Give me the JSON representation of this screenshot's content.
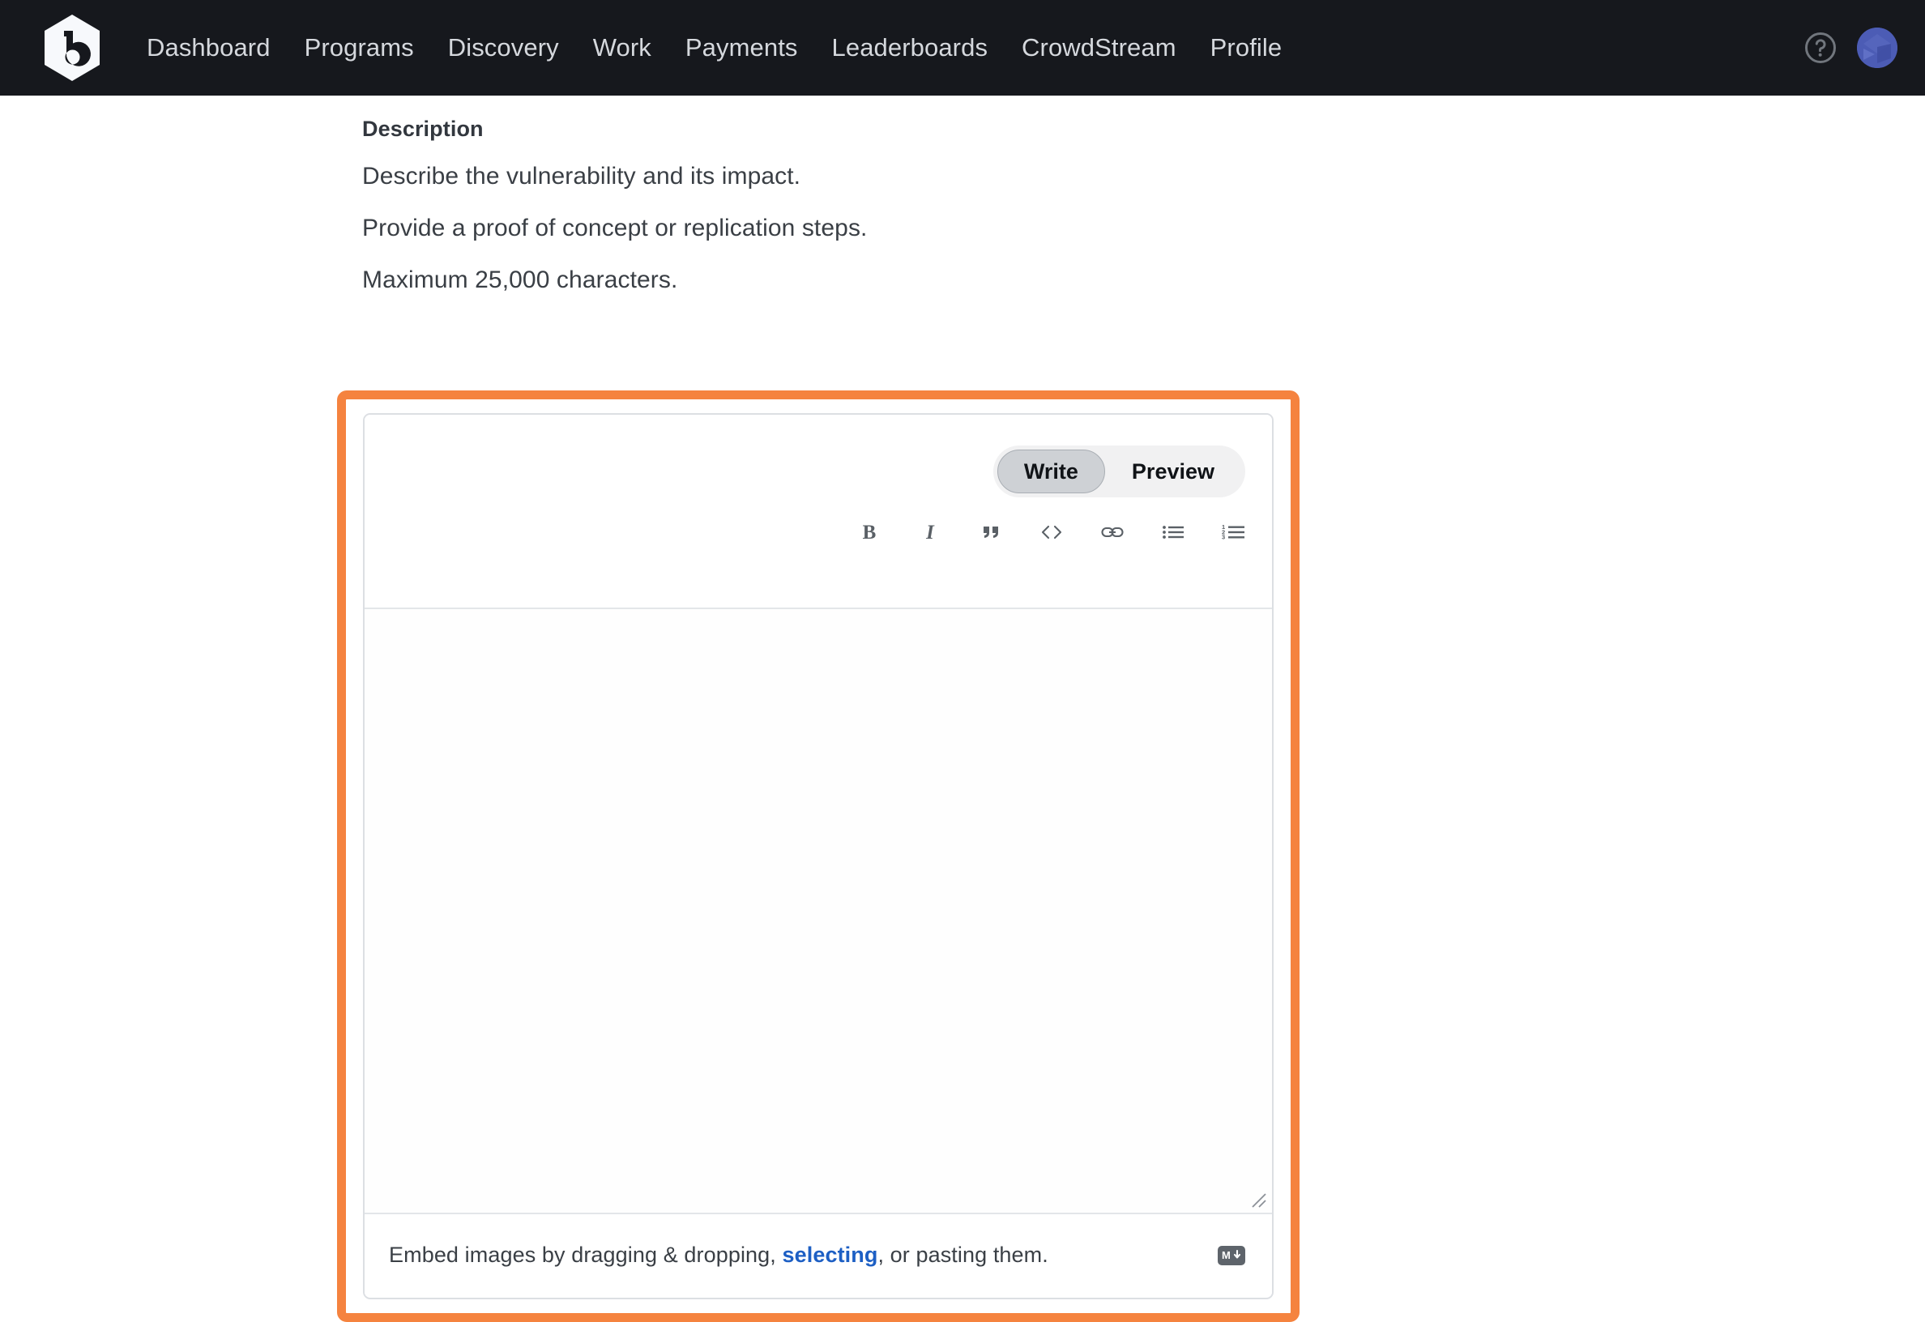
{
  "navbar": {
    "logo_name": "bugcrowd-logo",
    "background_color": "#16181d",
    "links": [
      {
        "label": "Dashboard",
        "name": "nav-link-dashboard"
      },
      {
        "label": "Programs",
        "name": "nav-link-programs"
      },
      {
        "label": "Discovery",
        "name": "nav-link-discovery"
      },
      {
        "label": "Work",
        "name": "nav-link-work"
      },
      {
        "label": "Payments",
        "name": "nav-link-payments"
      },
      {
        "label": "Leaderboards",
        "name": "nav-link-leaderboards"
      },
      {
        "label": "CrowdStream",
        "name": "nav-link-crowdstream"
      },
      {
        "label": "Profile",
        "name": "nav-link-profile"
      }
    ],
    "help_icon": "help-circle-icon",
    "avatar_icon": "user-avatar",
    "avatar_color": "#4c5cb5"
  },
  "description": {
    "title": "Description",
    "line1": "Describe the vulnerability and its impact.",
    "line2": "Provide a proof of concept or replication steps.",
    "line3": "Maximum 25,000 characters."
  },
  "editor": {
    "tabs": {
      "write": "Write",
      "preview": "Preview",
      "active": "Write"
    },
    "toolbar": [
      {
        "name": "bold-icon",
        "label": "Bold"
      },
      {
        "name": "italic-icon",
        "label": "Italic"
      },
      {
        "name": "quote-icon",
        "label": "Quote"
      },
      {
        "name": "code-icon",
        "label": "Code"
      },
      {
        "name": "link-icon",
        "label": "Link"
      },
      {
        "name": "bullet-list-icon",
        "label": "Unordered list"
      },
      {
        "name": "numbered-list-icon",
        "label": "Ordered list"
      }
    ],
    "textarea": {
      "value": "",
      "placeholder": ""
    },
    "footer": {
      "text_before": "Embed images by dragging & dropping, ",
      "link": "selecting",
      "text_after": ", or pasting them.",
      "markdown_badge": "markdown-icon"
    }
  },
  "annotation": {
    "color": "#f5833f",
    "name": "highlight-box"
  }
}
